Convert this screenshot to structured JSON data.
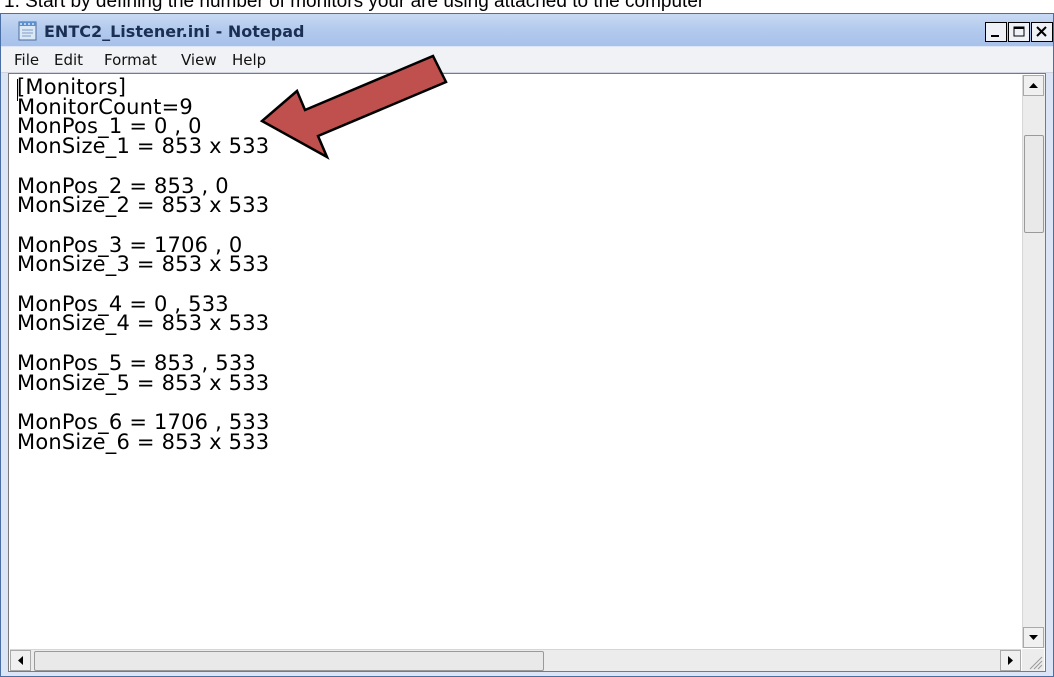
{
  "caption": "1.   Start by defining the number of monitors your are using attached to the computer",
  "window": {
    "title": "ENTC2_Listener.ini - Notepad",
    "controls": {
      "minimize": "minimize",
      "maximize": "maximize",
      "close": "close"
    }
  },
  "menu": [
    {
      "label": "File"
    },
    {
      "label": "Edit"
    },
    {
      "label": "Format"
    },
    {
      "label": "View"
    },
    {
      "label": "Help"
    }
  ],
  "editor": {
    "lines": [
      "[Monitors]",
      "MonitorCount=9",
      "MonPos_1 = 0 , 0",
      "MonSize_1 = 853 x 533",
      "",
      "MonPos_2 = 853 , 0",
      "MonSize_2 = 853 x 533",
      "",
      "MonPos_3 = 1706 , 0",
      "MonSize_3 = 853 x 533",
      "",
      "MonPos_4 = 0 , 533",
      "MonSize_4 = 853 x 533",
      "",
      "MonPos_5 = 853 , 533",
      "MonSize_5 = 853 x 533",
      "",
      "MonPos_6 = 1706 , 533",
      "MonSize_6 = 853 x 533"
    ]
  },
  "annotation": {
    "color": "#c0504d",
    "outline": "#000000",
    "icon": "arrow-annotation"
  },
  "colors": {
    "titlebar": "#b4cbee",
    "title_text": "#1b2f53",
    "menubar": "#f1f2f6"
  }
}
